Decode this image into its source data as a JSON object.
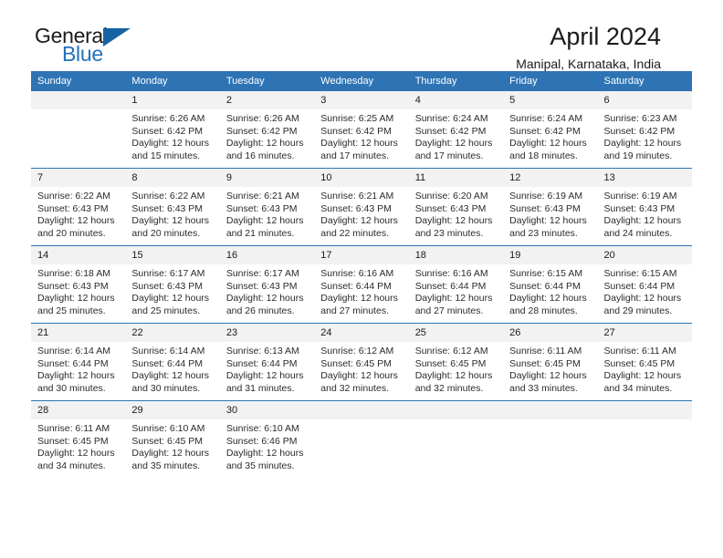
{
  "brand": {
    "word_general": "General",
    "word_blue": "Blue",
    "triangle_color": "#1464a5",
    "blue_color": "#2272b8"
  },
  "header": {
    "title": "April 2024",
    "subtitle": "Manipal, Karnataka, India"
  },
  "theme": {
    "header_blue": "#2e74b5",
    "daynum_gray": "#f2f2f2",
    "separator_blue": "#2e74b5"
  },
  "weekdays": [
    "Sunday",
    "Monday",
    "Tuesday",
    "Wednesday",
    "Thursday",
    "Friday",
    "Saturday"
  ],
  "weeks": [
    [
      {
        "day": "",
        "sunrise": "",
        "sunset": "",
        "daylight1": "",
        "daylight2": ""
      },
      {
        "day": "1",
        "sunrise": "Sunrise: 6:26 AM",
        "sunset": "Sunset: 6:42 PM",
        "daylight1": "Daylight: 12 hours",
        "daylight2": "and 15 minutes."
      },
      {
        "day": "2",
        "sunrise": "Sunrise: 6:26 AM",
        "sunset": "Sunset: 6:42 PM",
        "daylight1": "Daylight: 12 hours",
        "daylight2": "and 16 minutes."
      },
      {
        "day": "3",
        "sunrise": "Sunrise: 6:25 AM",
        "sunset": "Sunset: 6:42 PM",
        "daylight1": "Daylight: 12 hours",
        "daylight2": "and 17 minutes."
      },
      {
        "day": "4",
        "sunrise": "Sunrise: 6:24 AM",
        "sunset": "Sunset: 6:42 PM",
        "daylight1": "Daylight: 12 hours",
        "daylight2": "and 17 minutes."
      },
      {
        "day": "5",
        "sunrise": "Sunrise: 6:24 AM",
        "sunset": "Sunset: 6:42 PM",
        "daylight1": "Daylight: 12 hours",
        "daylight2": "and 18 minutes."
      },
      {
        "day": "6",
        "sunrise": "Sunrise: 6:23 AM",
        "sunset": "Sunset: 6:42 PM",
        "daylight1": "Daylight: 12 hours",
        "daylight2": "and 19 minutes."
      }
    ],
    [
      {
        "day": "7",
        "sunrise": "Sunrise: 6:22 AM",
        "sunset": "Sunset: 6:43 PM",
        "daylight1": "Daylight: 12 hours",
        "daylight2": "and 20 minutes."
      },
      {
        "day": "8",
        "sunrise": "Sunrise: 6:22 AM",
        "sunset": "Sunset: 6:43 PM",
        "daylight1": "Daylight: 12 hours",
        "daylight2": "and 20 minutes."
      },
      {
        "day": "9",
        "sunrise": "Sunrise: 6:21 AM",
        "sunset": "Sunset: 6:43 PM",
        "daylight1": "Daylight: 12 hours",
        "daylight2": "and 21 minutes."
      },
      {
        "day": "10",
        "sunrise": "Sunrise: 6:21 AM",
        "sunset": "Sunset: 6:43 PM",
        "daylight1": "Daylight: 12 hours",
        "daylight2": "and 22 minutes."
      },
      {
        "day": "11",
        "sunrise": "Sunrise: 6:20 AM",
        "sunset": "Sunset: 6:43 PM",
        "daylight1": "Daylight: 12 hours",
        "daylight2": "and 23 minutes."
      },
      {
        "day": "12",
        "sunrise": "Sunrise: 6:19 AM",
        "sunset": "Sunset: 6:43 PM",
        "daylight1": "Daylight: 12 hours",
        "daylight2": "and 23 minutes."
      },
      {
        "day": "13",
        "sunrise": "Sunrise: 6:19 AM",
        "sunset": "Sunset: 6:43 PM",
        "daylight1": "Daylight: 12 hours",
        "daylight2": "and 24 minutes."
      }
    ],
    [
      {
        "day": "14",
        "sunrise": "Sunrise: 6:18 AM",
        "sunset": "Sunset: 6:43 PM",
        "daylight1": "Daylight: 12 hours",
        "daylight2": "and 25 minutes."
      },
      {
        "day": "15",
        "sunrise": "Sunrise: 6:17 AM",
        "sunset": "Sunset: 6:43 PM",
        "daylight1": "Daylight: 12 hours",
        "daylight2": "and 25 minutes."
      },
      {
        "day": "16",
        "sunrise": "Sunrise: 6:17 AM",
        "sunset": "Sunset: 6:43 PM",
        "daylight1": "Daylight: 12 hours",
        "daylight2": "and 26 minutes."
      },
      {
        "day": "17",
        "sunrise": "Sunrise: 6:16 AM",
        "sunset": "Sunset: 6:44 PM",
        "daylight1": "Daylight: 12 hours",
        "daylight2": "and 27 minutes."
      },
      {
        "day": "18",
        "sunrise": "Sunrise: 6:16 AM",
        "sunset": "Sunset: 6:44 PM",
        "daylight1": "Daylight: 12 hours",
        "daylight2": "and 27 minutes."
      },
      {
        "day": "19",
        "sunrise": "Sunrise: 6:15 AM",
        "sunset": "Sunset: 6:44 PM",
        "daylight1": "Daylight: 12 hours",
        "daylight2": "and 28 minutes."
      },
      {
        "day": "20",
        "sunrise": "Sunrise: 6:15 AM",
        "sunset": "Sunset: 6:44 PM",
        "daylight1": "Daylight: 12 hours",
        "daylight2": "and 29 minutes."
      }
    ],
    [
      {
        "day": "21",
        "sunrise": "Sunrise: 6:14 AM",
        "sunset": "Sunset: 6:44 PM",
        "daylight1": "Daylight: 12 hours",
        "daylight2": "and 30 minutes."
      },
      {
        "day": "22",
        "sunrise": "Sunrise: 6:14 AM",
        "sunset": "Sunset: 6:44 PM",
        "daylight1": "Daylight: 12 hours",
        "daylight2": "and 30 minutes."
      },
      {
        "day": "23",
        "sunrise": "Sunrise: 6:13 AM",
        "sunset": "Sunset: 6:44 PM",
        "daylight1": "Daylight: 12 hours",
        "daylight2": "and 31 minutes."
      },
      {
        "day": "24",
        "sunrise": "Sunrise: 6:12 AM",
        "sunset": "Sunset: 6:45 PM",
        "daylight1": "Daylight: 12 hours",
        "daylight2": "and 32 minutes."
      },
      {
        "day": "25",
        "sunrise": "Sunrise: 6:12 AM",
        "sunset": "Sunset: 6:45 PM",
        "daylight1": "Daylight: 12 hours",
        "daylight2": "and 32 minutes."
      },
      {
        "day": "26",
        "sunrise": "Sunrise: 6:11 AM",
        "sunset": "Sunset: 6:45 PM",
        "daylight1": "Daylight: 12 hours",
        "daylight2": "and 33 minutes."
      },
      {
        "day": "27",
        "sunrise": "Sunrise: 6:11 AM",
        "sunset": "Sunset: 6:45 PM",
        "daylight1": "Daylight: 12 hours",
        "daylight2": "and 34 minutes."
      }
    ],
    [
      {
        "day": "28",
        "sunrise": "Sunrise: 6:11 AM",
        "sunset": "Sunset: 6:45 PM",
        "daylight1": "Daylight: 12 hours",
        "daylight2": "and 34 minutes."
      },
      {
        "day": "29",
        "sunrise": "Sunrise: 6:10 AM",
        "sunset": "Sunset: 6:45 PM",
        "daylight1": "Daylight: 12 hours",
        "daylight2": "and 35 minutes."
      },
      {
        "day": "30",
        "sunrise": "Sunrise: 6:10 AM",
        "sunset": "Sunset: 6:46 PM",
        "daylight1": "Daylight: 12 hours",
        "daylight2": "and 35 minutes."
      },
      {
        "day": "",
        "sunrise": "",
        "sunset": "",
        "daylight1": "",
        "daylight2": ""
      },
      {
        "day": "",
        "sunrise": "",
        "sunset": "",
        "daylight1": "",
        "daylight2": ""
      },
      {
        "day": "",
        "sunrise": "",
        "sunset": "",
        "daylight1": "",
        "daylight2": ""
      },
      {
        "day": "",
        "sunrise": "",
        "sunset": "",
        "daylight1": "",
        "daylight2": ""
      }
    ]
  ]
}
